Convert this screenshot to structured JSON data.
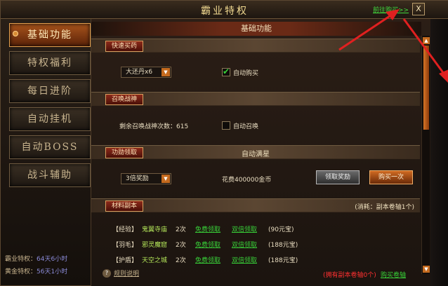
{
  "window": {
    "title": "霸业特权",
    "goto_buy": "前往购买>>",
    "close": "X"
  },
  "nav": {
    "items": [
      {
        "label": "基础功能",
        "active": true
      },
      {
        "label": "特权福利"
      },
      {
        "label": "每日进阶"
      },
      {
        "label": "自动挂机"
      },
      {
        "label": "自动BOSS"
      },
      {
        "label": "战斗辅助"
      }
    ]
  },
  "left_footer": {
    "line1_label": "霸业特权：",
    "line1_value": "64天6小时",
    "line2_label": "黄金特权：",
    "line2_value": "56天1小时"
  },
  "content": {
    "header": "基础功能",
    "sections": {
      "quick_buy": {
        "tag": "快速买药",
        "select_value": "大还丹x6",
        "checkbox_label": "自动购买",
        "checked": true
      },
      "summon": {
        "tag": "召唤战神",
        "remaining": "剩余召唤战神次数：615",
        "checkbox_label": "自动召唤",
        "checked": false
      },
      "star": {
        "tag": "功勋领取",
        "center": "自动满星",
        "select_value": "3倍奖励",
        "cost": "花费400000金币",
        "btn_claim": "领取奖励",
        "btn_buy": "购买一次"
      },
      "dungeon": {
        "tag": "材料副本",
        "consume": "(消耗：副本卷轴1个)",
        "rows": [
          {
            "name": "【经验】",
            "place": "鬼翼寺庙",
            "count": "2次",
            "free": "免费领取",
            "double": "双倍领取",
            "cost": "(90元宝)"
          },
          {
            "name": "【羽毛】",
            "place": "邪灵魔窟",
            "count": "2次",
            "free": "免费领取",
            "double": "双倍领取",
            "cost": "(188元宝)"
          },
          {
            "name": "【护盾】",
            "place": "天空之城",
            "count": "2次",
            "free": "免费领取",
            "double": "双倍领取",
            "cost": "(188元宝)"
          }
        ]
      }
    },
    "footer": {
      "help": "规则说明",
      "own": "(拥有副本卷轴0个)",
      "buy": "购买卷轴"
    }
  },
  "colors": {
    "accent": "#c46a1e",
    "link_green": "#38d038",
    "warning_red": "#ff3030"
  },
  "icons": {
    "help": "question-icon",
    "checkbox": "check-icon",
    "dropdown": "chevron-down-icon"
  }
}
